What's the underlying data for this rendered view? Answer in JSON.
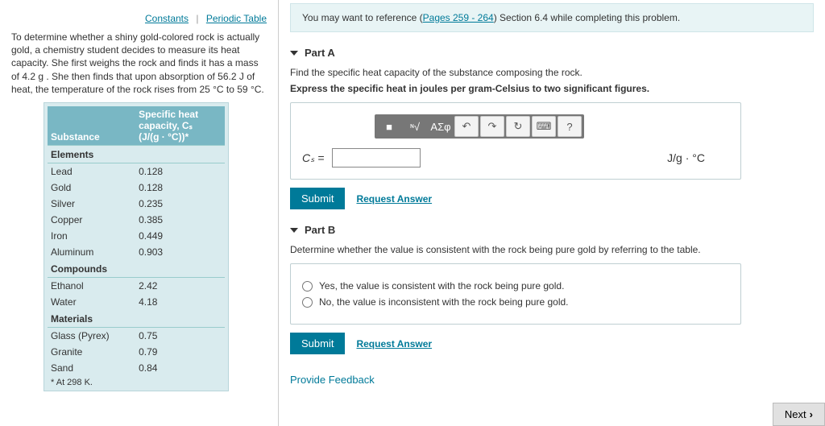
{
  "left": {
    "links": {
      "constants": "Constants",
      "periodic": "Periodic Table"
    },
    "intro": "To determine whether a shiny gold-colored rock is actually gold, a chemistry student decides to measure its heat capacity. She first weighs the rock and finds it has a mass of 4.2 g . She then finds that upon absorption of 56.2 J of heat, the temperature of the rock rises from 25 °C to 59 °C.",
    "table": {
      "col1": "Substance",
      "col2a": "Specific heat",
      "col2b": "capacity, Cₛ",
      "col2c": "(J/(g · °C))*",
      "sections": [
        {
          "title": "Elements",
          "rows": [
            {
              "n": "Lead",
              "v": "0.128"
            },
            {
              "n": "Gold",
              "v": "0.128"
            },
            {
              "n": "Silver",
              "v": "0.235"
            },
            {
              "n": "Copper",
              "v": "0.385"
            },
            {
              "n": "Iron",
              "v": "0.449"
            },
            {
              "n": "Aluminum",
              "v": "0.903"
            }
          ]
        },
        {
          "title": "Compounds",
          "rows": [
            {
              "n": "Ethanol",
              "v": "2.42"
            },
            {
              "n": "Water",
              "v": "4.18"
            }
          ]
        },
        {
          "title": "Materials",
          "rows": [
            {
              "n": "Glass (Pyrex)",
              "v": "0.75"
            },
            {
              "n": "Granite",
              "v": "0.79"
            },
            {
              "n": "Sand",
              "v": "0.84"
            }
          ]
        }
      ],
      "footnote": "* At 298 K."
    }
  },
  "hint": {
    "pre": "You may want to reference (",
    "link": "Pages 259 - 264",
    "post": ") Section 6.4 while completing this problem."
  },
  "partA": {
    "title": "Part A",
    "instr1": "Find the specific heat capacity of the substance composing the rock.",
    "instr2": "Express the specific heat in joules per gram-Celsius to two significant figures.",
    "var": "Cₛ =",
    "unit": "J/g · °C",
    "toolbar": {
      "t1": "■",
      "t2": "ᶰ√",
      "t3": "ΑΣφ",
      "undo": "↶",
      "redo": "↷",
      "reset": "↻",
      "kbd": "⌨",
      "help": "?"
    },
    "submit": "Submit",
    "req": "Request Answer"
  },
  "partB": {
    "title": "Part B",
    "instr": "Determine whether the value is consistent with the rock being pure gold by referring to the table.",
    "opt1": "Yes, the value is consistent with the rock being pure gold.",
    "opt2": "No, the value is inconsistent with the rock being pure gold.",
    "submit": "Submit",
    "req": "Request Answer"
  },
  "feedback": "Provide Feedback",
  "next": "Next"
}
